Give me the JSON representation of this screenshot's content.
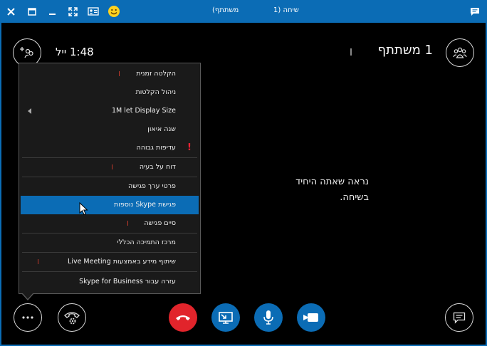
{
  "titlebar": {
    "title_left": "שיחה (1",
    "title_right": "משתתף)"
  },
  "header": {
    "participants": "1 משתתף",
    "timer": "1:48 ייל"
  },
  "main": {
    "alone_line1": "נראה שאתה היחיד",
    "alone_line2": "בשיחה."
  },
  "menu": {
    "items": [
      {
        "label": "הקלטה זמנית"
      },
      {
        "label": "ניהול הקלטות"
      },
      {
        "label": "1M let Display Size"
      },
      {
        "label": "שנה איאון"
      },
      {
        "label": "עדיפות גבוהה"
      },
      {
        "label": "דוח על בעיה"
      },
      {
        "label": "פרטי ערך פגישה"
      },
      {
        "label": "פגישת Skype נוספות"
      },
      {
        "label": "סיים פגישה"
      },
      {
        "label": "מרכז התמיכה הכללי"
      },
      {
        "label": "שיתוף מידע באמצעות Live Meeting"
      },
      {
        "label": "עזרה עבור Skype for Business"
      }
    ],
    "exclamation": "!"
  },
  "colors": {
    "brand_blue": "#0b6cb5",
    "hangup_red": "#e1242b"
  },
  "icons": {
    "close": "close-icon",
    "window": "window-icon",
    "minimize": "minimize-icon",
    "fullscreen": "fullscreen-icon",
    "contact_card": "contact-card-icon",
    "emoji": "emoji-icon",
    "chat": "chat-icon"
  }
}
